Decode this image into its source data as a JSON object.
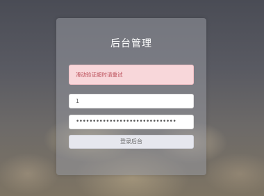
{
  "login": {
    "title": "后台管理",
    "alert_text": "滑动验证超时请重试",
    "username_value": "1",
    "password_masked": "••••••••••••••••••••••••••••••",
    "submit_label": "登录后台"
  },
  "colors": {
    "alert_background": "#f8d7da",
    "alert_text": "#b94a55",
    "button_background": "#e6e7ee"
  }
}
